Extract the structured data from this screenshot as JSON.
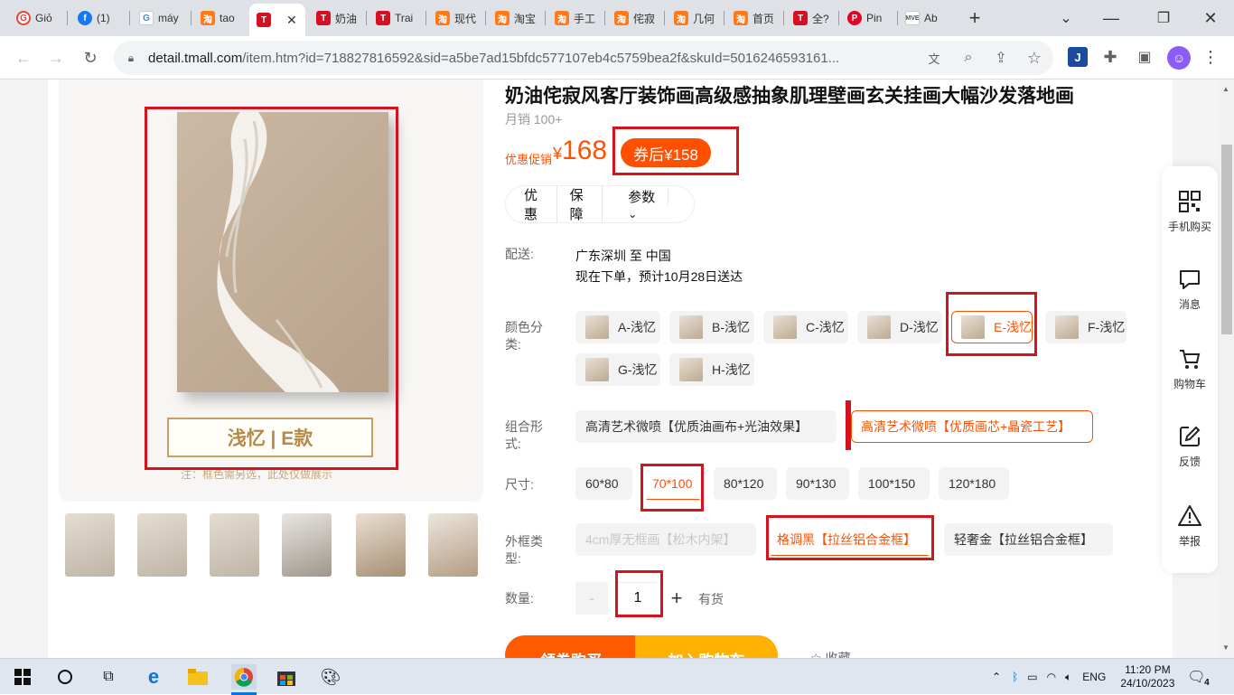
{
  "browser": {
    "tabs": [
      {
        "label": "Giỏ",
        "icon": "google-icon",
        "color": "#ea4335"
      },
      {
        "label": "(1)",
        "icon": "facebook-icon",
        "color": "#1877f2"
      },
      {
        "label": "máy",
        "icon": "google-icon",
        "color": "#4285f4"
      },
      {
        "label": "tao",
        "icon": "taobao-icon",
        "color": "#ff5000"
      },
      {
        "label": "",
        "icon": "tmall-icon",
        "color": "#d70f23"
      },
      {
        "label": "奶油",
        "icon": "tmall-icon",
        "color": "#d70f23"
      },
      {
        "label": "Trai",
        "icon": "tmall-icon",
        "color": "#d70f23"
      },
      {
        "label": "现代",
        "icon": "taobao-icon",
        "color": "#ff5000"
      },
      {
        "label": "淘宝",
        "icon": "taobao-icon",
        "color": "#ff5000"
      },
      {
        "label": "手工",
        "icon": "taobao-icon",
        "color": "#ff5000"
      },
      {
        "label": "侘寂",
        "icon": "taobao-icon",
        "color": "#ff5000"
      },
      {
        "label": "几何",
        "icon": "taobao-icon",
        "color": "#ff5000"
      },
      {
        "label": "首页",
        "icon": "taobao-icon",
        "color": "#ff5000"
      },
      {
        "label": "全?",
        "icon": "tmall-icon",
        "color": "#d70f23"
      },
      {
        "label": "Pin",
        "icon": "pinterest-icon",
        "color": "#e60023"
      },
      {
        "label": "Ab",
        "icon": "mve-icon",
        "color": "#555555"
      }
    ],
    "url_host": "detail.tmall.com",
    "url_rest": "/item.htm?id=718827816592&sid=a5be7ad15bfdc577107eb4c5759bea2f&skuId=5016246593161..."
  },
  "product": {
    "title": "奶油侘寂风客厅装饰画高级感抽象肌理壁画玄关挂画大幅沙发落地画",
    "sales": "月销 100+",
    "price_label": "优惠促销",
    "currency": "¥",
    "price": "168",
    "coupon": "券后¥158",
    "info_tabs": [
      "优惠",
      "保障",
      "参数"
    ],
    "image_caption": "浅忆 | E款",
    "image_note": "注：框色需另选，此处仅做展示",
    "shipping_label": "配送:",
    "shipping_from": "广东深圳 至 中国",
    "shipping_eta": "现在下单，预计10月28日送达",
    "color_label": "颜色分类:",
    "colors": [
      "A-浅忆",
      "B-浅忆",
      "C-浅忆",
      "D-浅忆",
      "E-浅忆",
      "F-浅忆",
      "G-浅忆",
      "H-浅忆"
    ],
    "combo_label": "组合形式:",
    "combos": [
      "高清艺术微喷【优质油画布+光油效果】",
      "高清艺术微喷【优质画芯+晶瓷工艺】"
    ],
    "size_label": "尺寸:",
    "sizes": [
      "60*80",
      "70*100",
      "80*120",
      "90*130",
      "100*150",
      "120*180"
    ],
    "frame_label": "外框类型:",
    "frames": [
      "4cm厚无框画【松木内架】",
      "格调黑【拉丝铝合金框】",
      "轻奢金【拉丝铝合金框】"
    ],
    "qty_label": "数量:",
    "qty_minus": "-",
    "qty_value": "1",
    "qty_plus": "+",
    "stock": "有货",
    "buy_coupon": "领券购买",
    "add_cart": "加入购物车",
    "favorite": "☆ 收藏"
  },
  "sidebar": [
    {
      "label": "手机购买",
      "icon": "qrcode-icon"
    },
    {
      "label": "消息",
      "icon": "message-icon"
    },
    {
      "label": "购物车",
      "icon": "cart-icon"
    },
    {
      "label": "反馈",
      "icon": "edit-icon"
    },
    {
      "label": "举报",
      "icon": "warning-icon"
    }
  ],
  "taskbar": {
    "lang": "ENG",
    "time": "11:20 PM",
    "date": "24/10/2023",
    "notifications": "4"
  }
}
